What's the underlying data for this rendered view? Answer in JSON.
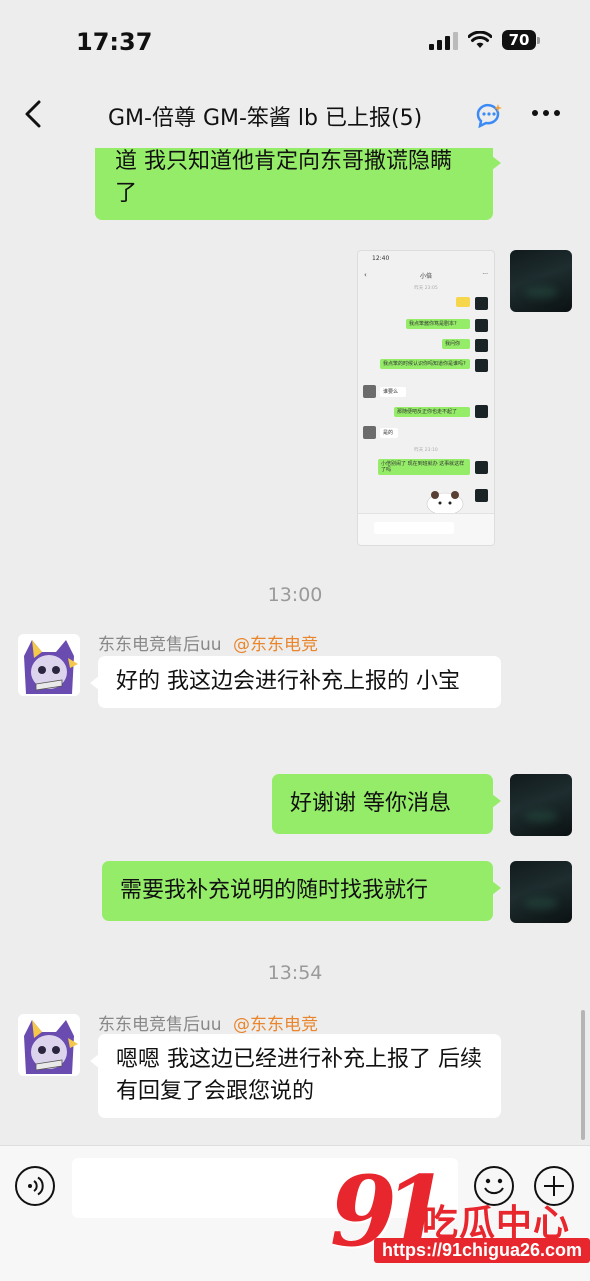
{
  "status_bar": {
    "time": "17:37",
    "battery": "70"
  },
  "header": {
    "title": "GM-倍尊 GM-笨酱  lb 已上报(5)"
  },
  "messages": {
    "m1": {
      "text": "道 我只知道他肯定向东哥撒谎隐瞒了"
    },
    "m2": {
      "screenshot": {
        "time": "12:40",
        "title": "小倍",
        "ts1": "昨天 23:05",
        "b1": "我点笨酱你笃是剧本?",
        "b2": "我问你",
        "b3": "我点笨的时候认识你吗知道你是谁吗?",
        "w1": "谁要么",
        "b4": "那随便吧反正你也走不起了",
        "w2": "是的",
        "ts2": "昨天 23:10",
        "b5": "小倍别闹了 现在到班就办 这事就这样了吗"
      }
    },
    "ts1": "13:00",
    "m3": {
      "sender": "东东电竞售后uu",
      "tag": "@东东电竞",
      "text": "好的 我这边会进行补充上报的 小宝"
    },
    "m4": {
      "text": "好谢谢 等你消息"
    },
    "m5": {
      "text": "需要我补充说明的随时找我就行"
    },
    "ts2": "13:54",
    "m6": {
      "sender": "东东电竞售后uu",
      "tag": "@东东电竞",
      "text": "嗯嗯 我这边已经进行补充上报了 后续有回复了会跟您说的"
    }
  },
  "watermark": {
    "num": "91",
    "brand": "吃瓜中心",
    "url": "https://91chigua26.com"
  }
}
